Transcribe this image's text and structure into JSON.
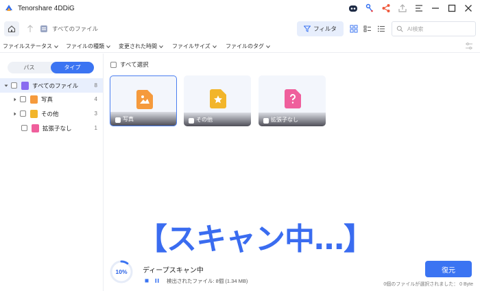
{
  "app": {
    "title": "Tenorshare 4DDiG"
  },
  "toolbar": {
    "breadcrumb": "すべてのファイル",
    "filter_label": "フィルタ",
    "search_placeholder": "AI検索"
  },
  "filterbar": {
    "items": [
      "ファイルステータス",
      "ファイルの種類",
      "変更された時間",
      "ファイルサイズ",
      "ファイルのタグ"
    ]
  },
  "sidebar": {
    "tabs": {
      "path": "パス",
      "type": "タイプ",
      "active": "type"
    },
    "tree": [
      {
        "label": "すべてのファイル",
        "count": "8",
        "icon": "all-files-icon",
        "color": "#8a6cf0"
      },
      {
        "label": "写真",
        "count": "4",
        "icon": "photo-icon",
        "color": "#f59a3c"
      },
      {
        "label": "その他",
        "count": "3",
        "icon": "other-icon",
        "color": "#f2b52a"
      },
      {
        "label": "拡張子なし",
        "count": "1",
        "icon": "no-extension-icon",
        "color": "#ef5f9c"
      }
    ]
  },
  "content": {
    "select_all": "すべて選択",
    "cards": [
      {
        "label": "写真",
        "icon": "photo-icon",
        "color": "#f59a3c"
      },
      {
        "label": "その他",
        "icon": "star-file-icon",
        "color": "#f2b52a"
      },
      {
        "label": "拡張子なし",
        "icon": "question-file-icon",
        "color": "#ef5f9c"
      }
    ]
  },
  "overlay": {
    "caption": "【スキャン中…】"
  },
  "bottom": {
    "progress": "10%",
    "progress_fraction": 0.1,
    "scan_title": "ディープスキャン中",
    "found_text": "検出されたファイル: 8個 (1.34 MB)",
    "restore_label": "復元",
    "selected_info": "0個のファイルが選択されました： 0 Byte"
  },
  "colors": {
    "accent": "#3b74f2",
    "overlay_text": "#3a6cf0"
  }
}
